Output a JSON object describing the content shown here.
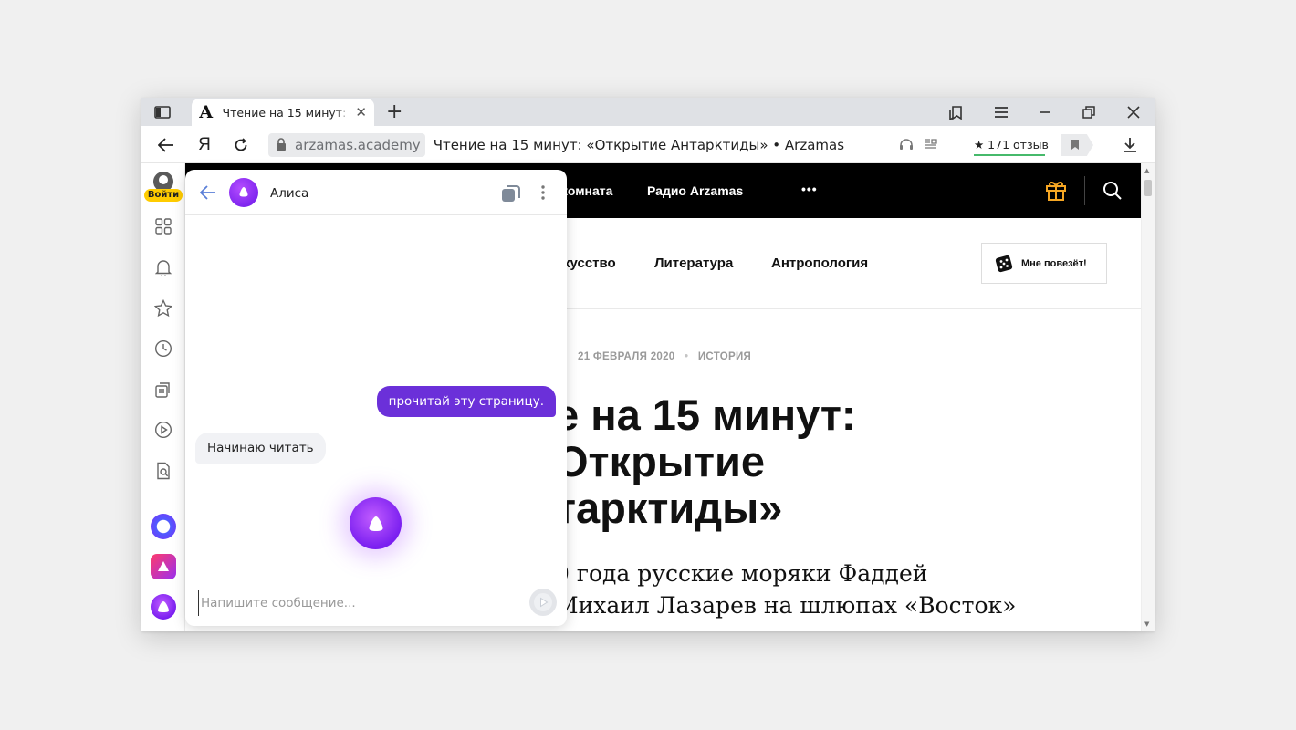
{
  "browser": {
    "tab": {
      "favicon": "А",
      "title": "Чтение на 15 минут: «Открытие Антарктиды» • Arzamas",
      "close": "✕"
    },
    "new_tab": "+",
    "nav": {
      "back": "arrow-left-icon",
      "yandex_logo": "Я",
      "reload": "reload-icon"
    },
    "address": {
      "domain": "arzamas.academy",
      "page_title": "Чтение на 15 минут: «Открытие Антарктиды» • Arzamas"
    },
    "reviews": "★ 171 отзыв"
  },
  "rail": {
    "login": "Войти"
  },
  "site": {
    "header_links": [
      "комната",
      "Радио Arzamas",
      "•••"
    ],
    "categories": [
      "кусство",
      "Литература",
      "Антропология"
    ],
    "lucky_button": "Мне повезёт!",
    "meta_date": "21 ФЕВРАЛЯ 2020",
    "meta_sep": "•",
    "meta_section": "ИСТОРИЯ",
    "headline": [
      "е на 15 минут:",
      "Открытие",
      "тарктиды»"
    ],
    "lead": [
      "0 года русские моряки Фаддей",
      "Михаил Лазарев на шлюпах «Восток»"
    ]
  },
  "alice": {
    "name": "Алиса",
    "user_message": "прочитай эту страницу.",
    "bot_message": "Начинаю читать",
    "input_placeholder": "Напишите сообщение..."
  },
  "colors": {
    "accent_purple": "#6b30d9",
    "yandex_yellow": "#ffcc00",
    "gift_orange": "#f5a623"
  }
}
